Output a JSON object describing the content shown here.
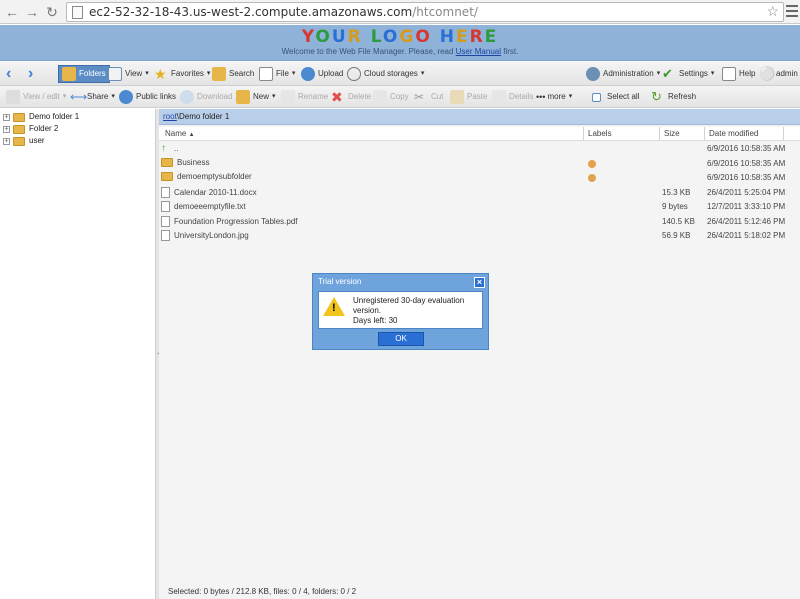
{
  "browser": {
    "url_host": "ec2-52-32-18-43.us-west-2.compute.amazonaws.com",
    "url_path": "/htcomnet/"
  },
  "header": {
    "logo_text": "YOUR LOGO HERE",
    "welcome_prefix": "Welcome to the Web File Manager. Please, read ",
    "welcome_link": "User Manual",
    "welcome_suffix": " first."
  },
  "toolbar1": {
    "folders": "Folders",
    "view": "View",
    "favorites": "Favorites",
    "search": "Search",
    "file": "File",
    "upload": "Upload",
    "cloud": "Cloud storages",
    "administration": "Administration",
    "settings": "Settings",
    "help": "Help",
    "user": "admin"
  },
  "toolbar2": {
    "view_edit": "View / edit",
    "share": "Share",
    "public_links": "Public links",
    "download": "Download",
    "new": "New",
    "rename": "Rename",
    "delete": "Delete",
    "copy": "Copy",
    "cut": "Cut",
    "paste": "Paste",
    "details": "Details",
    "more": "more",
    "select_all": "Select all",
    "refresh": "Refresh"
  },
  "tree": {
    "items": [
      {
        "label": "Demo folder 1"
      },
      {
        "label": "Folder 2"
      },
      {
        "label": "user"
      }
    ]
  },
  "path": {
    "root": "root",
    "rest": "\\Demo folder 1"
  },
  "columns": {
    "name": "Name",
    "labels": "Labels",
    "size": "Size",
    "date": "Date modified"
  },
  "files": [
    {
      "name": "..",
      "size": "",
      "date": "6/9/2016 10:58:35 AM",
      "label": false,
      "type": "up"
    },
    {
      "name": "Business",
      "size": "",
      "date": "6/9/2016 10:58:35 AM",
      "label": true,
      "type": "folder"
    },
    {
      "name": "demoemptysubfolder",
      "size": "",
      "date": "6/9/2016 10:58:35 AM",
      "label": true,
      "type": "folder"
    },
    {
      "name": "Calendar 2010-11.docx",
      "size": "15.3 KB",
      "date": "26/4/2011 5:25:04 PM",
      "label": false,
      "type": "file"
    },
    {
      "name": "demoeeemptyfile.txt",
      "size": "9 bytes",
      "date": "12/7/2011 3:33:10 PM",
      "label": false,
      "type": "file"
    },
    {
      "name": "Foundation Progression Tables.pdf",
      "size": "140.5 KB",
      "date": "26/4/2011 5:12:46 PM",
      "label": false,
      "type": "file"
    },
    {
      "name": "UniversityLondon.jpg",
      "size": "56.9 KB",
      "date": "26/4/2011 5:18:02 PM",
      "label": false,
      "type": "file"
    }
  ],
  "status": "Selected: 0 bytes / 212.8 KB, files: 0 / 4, folders: 0 / 2",
  "dialog": {
    "title": "Trial version",
    "line1": "Unregistered 30-day evaluation",
    "line2": "version.",
    "line3": "Days left: 30",
    "ok": "OK"
  },
  "colors": {
    "banner": "#8fb2d9",
    "accent": "#2a6fd3",
    "label_dot": "#e3a34a"
  }
}
